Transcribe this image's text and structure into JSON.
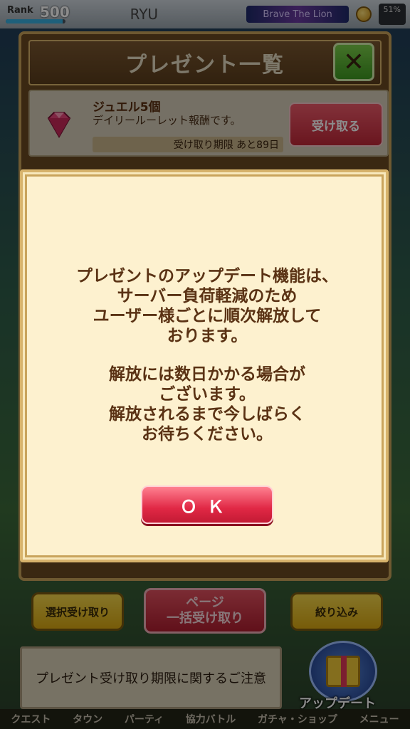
{
  "status_bar": {
    "rank_label": "Rank",
    "rank_value": "500",
    "rank_progress": 0.95,
    "player_name": "RYU",
    "title_badge": "Brave The Lion",
    "battery": "51%"
  },
  "present_window": {
    "title": "プレゼント一覧",
    "close_icon": "close-x-icon",
    "items": [
      {
        "icon": "jewel-icon",
        "name": "ジュエル5個",
        "description": "デイリールーレット報酬です。",
        "deadline": "受け取り期限  あと89日",
        "receive_label": "受け取る"
      }
    ],
    "select_label": "選択受け取り",
    "bulk_label_line1": "ページ",
    "bulk_label_line2": "一括受け取り",
    "filter_label": "絞り込み",
    "notice_label": "プレゼント受け取り期限に関するご注意"
  },
  "side_buttons": {
    "update_label": "アップデート",
    "update_icon": "gift-box-icon"
  },
  "bottom_nav": [
    "クエスト",
    "タウン",
    "パーティ",
    "協力バトル",
    "ガチャ・ショップ",
    "メニュー"
  ],
  "modal": {
    "message_part1": "プレゼントのアップデート機能は、\nサーバー負荷軽減のため\nユーザー様ごとに順次解放して\nおります。",
    "message_part2": "解放には数日かかる場合が\nございます。\n解放されるまで今しばらく\nお待ちください。",
    "ok_label": "ＯＫ"
  }
}
